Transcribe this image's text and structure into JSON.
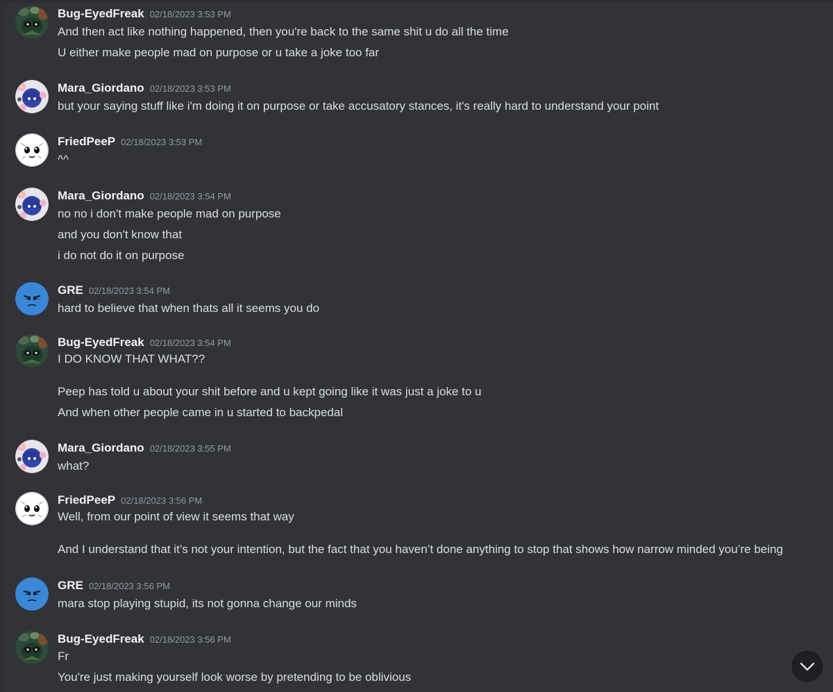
{
  "messages": [
    {
      "user": "Bug-EyedFreak",
      "avatar": "bug-eyed-freak-avatar",
      "time": "02/18/2023 3:53 PM",
      "lines": [
        "And then act like nothing happened, then you're back to the same shit u do all the time",
        "U either make people mad on purpose or u take a joke too far"
      ]
    },
    {
      "user": "Mara_Giordano",
      "avatar": "mara-giordano-avatar",
      "time": "02/18/2023 3:53 PM",
      "lines": [
        "but your saying stuff like i'm doing it on purpose or take accusatory stances, it's really hard to understand your point"
      ]
    },
    {
      "user": "FriedPeeP",
      "avatar": "friedpeep-avatar",
      "time": "02/18/2023 3:53 PM",
      "lines": [
        "^^"
      ]
    },
    {
      "user": "Mara_Giordano",
      "avatar": "mara-giordano-avatar",
      "time": "02/18/2023 3:54 PM",
      "lines": [
        "no no i don't make people mad on purpose",
        "and you don't know that",
        "i do not do it on purpose"
      ]
    },
    {
      "user": "GRE",
      "avatar": "gre-avatar",
      "time": "02/18/2023 3:54 PM",
      "lines": [
        "hard to believe that when thats all it seems you do"
      ]
    },
    {
      "user": "Bug-EyedFreak",
      "avatar": "bug-eyed-freak-avatar",
      "time": "02/18/2023 3:54 PM",
      "lines": [
        "I DO KNOW THAT WHAT??",
        "Peep has told u about your shit before and u kept going like it was just a joke to u",
        "And when other people came in u started to backpedal"
      ]
    },
    {
      "user": "Mara_Giordano",
      "avatar": "mara-giordano-avatar",
      "time": "02/18/2023 3:55 PM",
      "lines": [
        "what?"
      ]
    },
    {
      "user": "FriedPeeP",
      "avatar": "friedpeep-avatar",
      "time": "02/18/2023 3:56 PM",
      "lines": [
        "Well, from our point of view it seems that way",
        "And I understand that it’s not your intention, but the fact that you haven’t done anything to stop that shows how narrow minded you’re being"
      ]
    },
    {
      "user": "GRE",
      "avatar": "gre-avatar",
      "time": "02/18/2023 3:56 PM",
      "lines": [
        "mara stop playing stupid, its not gonna change our minds"
      ]
    },
    {
      "user": "Bug-EyedFreak",
      "avatar": "bug-eyed-freak-avatar",
      "time": "02/18/2023 3:56 PM",
      "lines": [
        "Fr",
        "You're just making yourself look worse by pretending to be oblivious"
      ]
    }
  ],
  "scroll_button": {
    "icon": "chevron-down-icon"
  },
  "colors": {
    "background": "#313338",
    "username": "#f2f3f5",
    "timestamp": "#949ba4",
    "text": "#dbdee1"
  }
}
